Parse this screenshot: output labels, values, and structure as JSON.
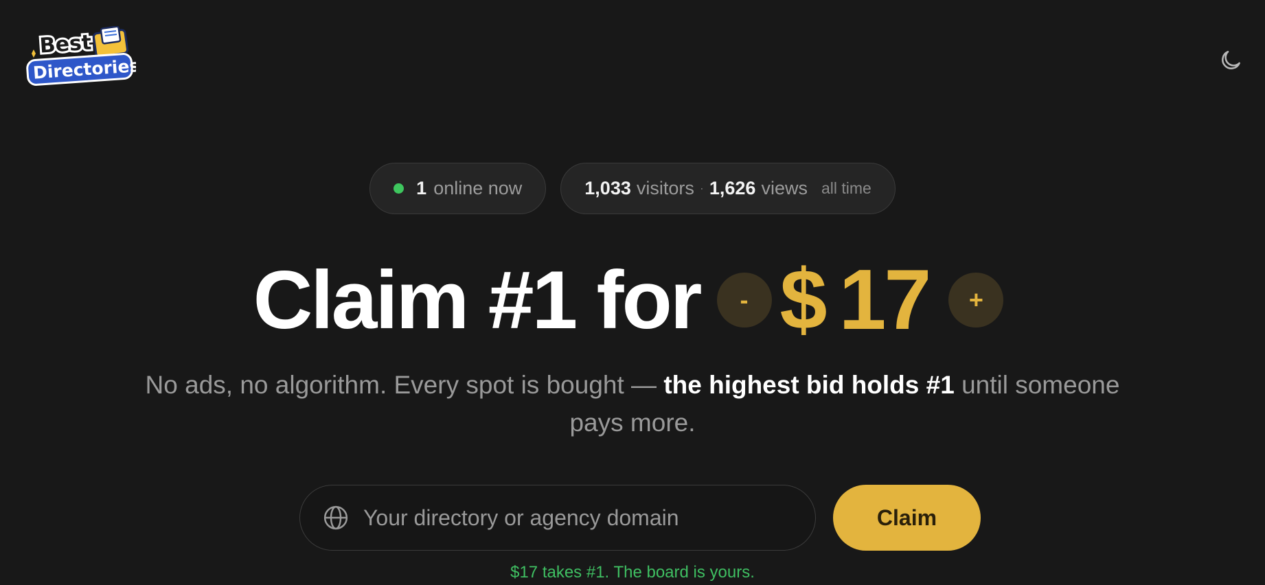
{
  "header": {
    "logo_line1": "Best",
    "logo_line2": "Directories",
    "theme_icon": "moon-icon"
  },
  "stats": {
    "online_count": "1",
    "online_label": "online now",
    "visitors_count": "1,033",
    "visitors_label": "visitors",
    "separator": "·",
    "views_count": "1,626",
    "views_label": "views",
    "period": "all time",
    "online_dot_color": "#3ec65e"
  },
  "hero": {
    "headline": "Claim #1 for",
    "decrease_label": "-",
    "currency": "$",
    "price": "17",
    "increase_label": "+",
    "subtitle_before": "No ads, no algorithm. Every spot is bought — ",
    "subtitle_emphasis": "the highest bid holds #1",
    "subtitle_after": " until someone pays more.",
    "accent_color": "#e3b43e"
  },
  "claim_form": {
    "input_icon": "globe-icon",
    "placeholder": "Your directory or agency domain",
    "value": "",
    "button_label": "Claim",
    "hint": "$17 takes #1. The board is yours."
  }
}
